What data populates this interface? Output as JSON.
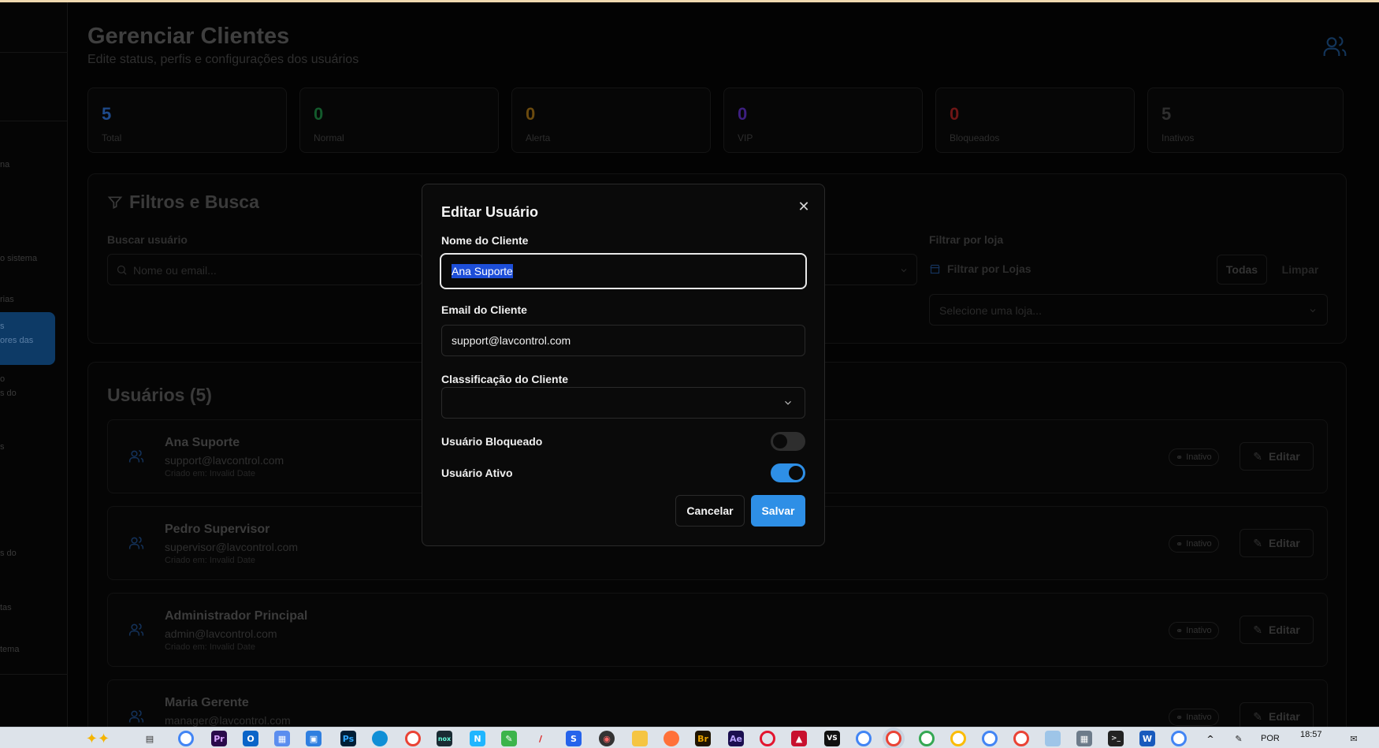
{
  "page": {
    "title": "Gerenciar Clientes",
    "subtitle": "Edite status, perfis e configurações dos usuários"
  },
  "sidebar": {
    "fragments": [
      "na",
      "o sistema",
      "rias",
      "s",
      "ores das",
      "o",
      "s do",
      "s",
      "s do",
      "tas",
      "tema"
    ]
  },
  "stats": [
    {
      "value": "5",
      "label": "Total",
      "color": "#2563eb"
    },
    {
      "value": "0",
      "label": "Normal",
      "color": "#15803d"
    },
    {
      "value": "0",
      "label": "Alerta",
      "color": "#a16207"
    },
    {
      "value": "0",
      "label": "VIP",
      "color": "#6d28d9"
    },
    {
      "value": "0",
      "label": "Bloqueados",
      "color": "#b91c1c"
    },
    {
      "value": "5",
      "label": "Inativos",
      "color": "#3a3a3a"
    }
  ],
  "filters": {
    "title": "Filtros e Busca",
    "search_label": "Buscar usuário",
    "search_placeholder": "Nome ou email...",
    "store_label": "Filtrar por loja",
    "store_filter_text": "Filtrar por Lojas",
    "all_button": "Todas",
    "clear_button": "Limpar",
    "store_select_placeholder": "Selecione uma loja..."
  },
  "users": {
    "title": "Usuários (5)",
    "badge_label": "Inativo",
    "edit_label": "Editar",
    "rows": [
      {
        "name": "Ana Suporte",
        "email": "support@lavcontrol.com",
        "created": "Criado em: Invalid Date"
      },
      {
        "name": "Pedro Supervisor",
        "email": "supervisor@lavcontrol.com",
        "created": "Criado em: Invalid Date"
      },
      {
        "name": "Administrador Principal",
        "email": "admin@lavcontrol.com",
        "created": "Criado em: Invalid Date"
      },
      {
        "name": "Maria Gerente",
        "email": "manager@lavcontrol.com",
        "created": ""
      }
    ]
  },
  "modal": {
    "title": "Editar Usuário",
    "name_label": "Nome do Cliente",
    "name_value": "Ana Suporte",
    "email_label": "Email do Cliente",
    "email_value": "support@lavcontrol.com",
    "class_label": "Classificação do Cliente",
    "class_value": "",
    "blocked_label": "Usuário Bloqueado",
    "blocked": false,
    "active_label": "Usuário Ativo",
    "active": true,
    "cancel_label": "Cancelar",
    "save_label": "Salvar",
    "accent_color": "#2e8fe6"
  },
  "taskbar": {
    "apps": [
      "copilot",
      "task-view",
      "chrome",
      "premiere",
      "outlook",
      "calendar",
      "store",
      "photoshop",
      "edge",
      "chrome",
      "nox",
      "notion",
      "notepad",
      "pdf",
      "app",
      "app",
      "explorer",
      "firefox",
      "bridge",
      "after-effects",
      "opera",
      "app",
      "vs",
      "chrome",
      "chrome",
      "chrome",
      "chrome",
      "chrome",
      "chrome",
      "app",
      "calculator",
      "terminal",
      "word",
      "chrome"
    ],
    "language": "POR",
    "time": "18:57"
  }
}
